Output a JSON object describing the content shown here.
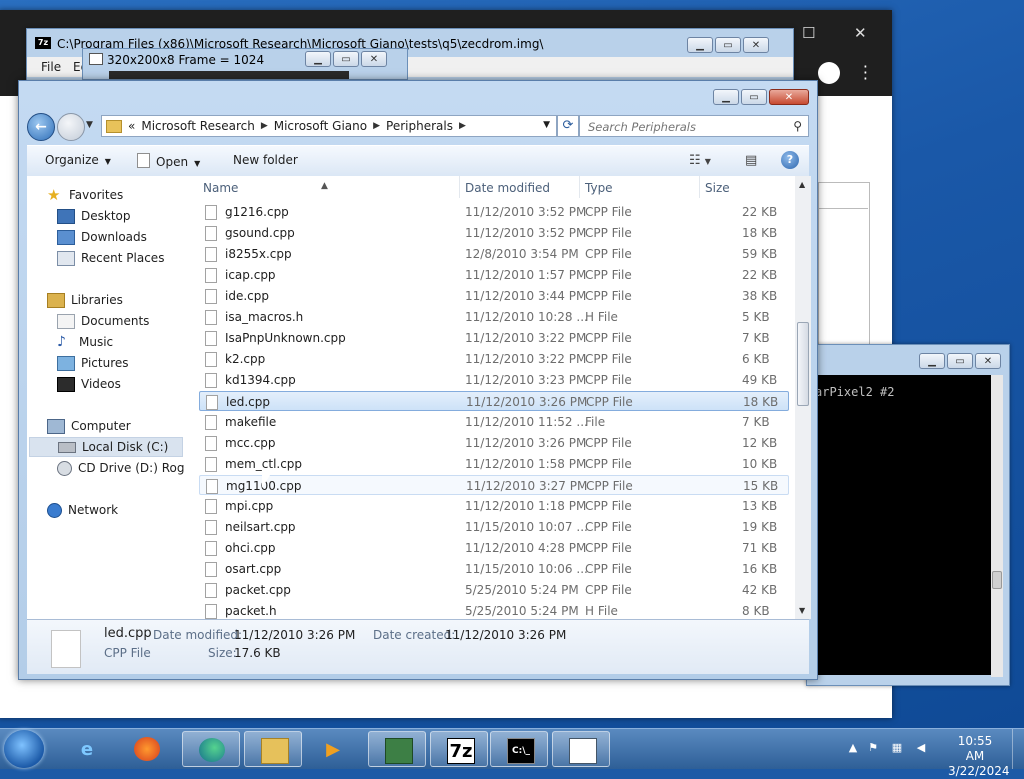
{
  "sevenzip": {
    "path": "C:\\Program Files (x86)\\Microsoft Research\\Microsoft Giano\\tests\\q5\\zecdrom.img\\",
    "menu_file": "File",
    "menu_edit": "Ed"
  },
  "frame_window": {
    "title": "320x200x8 Frame = 1024"
  },
  "console": {
    "text": "arPixel2 #2"
  },
  "explorer": {
    "breadcrumb": [
      "Microsoft Research",
      "Microsoft Giano",
      "Peripherals"
    ],
    "breadcrumb_overflow": "«",
    "search_placeholder": "Search Peripherals",
    "toolbar": {
      "organize": "Organize",
      "open": "Open",
      "new_folder": "New folder"
    },
    "nav": {
      "favorites": "Favorites",
      "desktop": "Desktop",
      "downloads": "Downloads",
      "recent": "Recent Places",
      "libraries": "Libraries",
      "documents": "Documents",
      "music": "Music",
      "pictures": "Pictures",
      "videos": "Videos",
      "computer": "Computer",
      "local_disk": "Local Disk (C:)",
      "cd_drive": "CD Drive (D:) Rogue",
      "network": "Network"
    },
    "columns": {
      "name": "Name",
      "date": "Date modified",
      "type": "Type",
      "size": "Size"
    },
    "files": [
      {
        "name": "g1216.cpp",
        "date": "11/12/2010 3:52 PM",
        "type": "CPP File",
        "size": "22 KB"
      },
      {
        "name": "gsound.cpp",
        "date": "11/12/2010 3:52 PM",
        "type": "CPP File",
        "size": "18 KB"
      },
      {
        "name": "i8255x.cpp",
        "date": "12/8/2010 3:54 PM",
        "type": "CPP File",
        "size": "59 KB"
      },
      {
        "name": "icap.cpp",
        "date": "11/12/2010 1:57 PM",
        "type": "CPP File",
        "size": "22 KB"
      },
      {
        "name": "ide.cpp",
        "date": "11/12/2010 3:44 PM",
        "type": "CPP File",
        "size": "38 KB"
      },
      {
        "name": "isa_macros.h",
        "date": "11/12/2010 10:28 ...",
        "type": "H File",
        "size": "5 KB"
      },
      {
        "name": "IsaPnpUnknown.cpp",
        "date": "11/12/2010 3:22 PM",
        "type": "CPP File",
        "size": "7 KB"
      },
      {
        "name": "k2.cpp",
        "date": "11/12/2010 3:22 PM",
        "type": "CPP File",
        "size": "6 KB"
      },
      {
        "name": "kd1394.cpp",
        "date": "11/12/2010 3:23 PM",
        "type": "CPP File",
        "size": "49 KB"
      },
      {
        "name": "led.cpp",
        "date": "11/12/2010 3:26 PM",
        "type": "CPP File",
        "size": "18 KB"
      },
      {
        "name": "makefile",
        "date": "11/12/2010 11:52 ...",
        "type": "File",
        "size": "7 KB"
      },
      {
        "name": "mcc.cpp",
        "date": "11/12/2010 3:26 PM",
        "type": "CPP File",
        "size": "12 KB"
      },
      {
        "name": "mem_ctl.cpp",
        "date": "11/12/2010 1:58 PM",
        "type": "CPP File",
        "size": "10 KB"
      },
      {
        "name": "mg1100.cpp",
        "date": "11/12/2010 3:27 PM",
        "type": "CPP File",
        "size": "15 KB"
      },
      {
        "name": "mpi.cpp",
        "date": "11/12/2010 1:18 PM",
        "type": "CPP File",
        "size": "13 KB"
      },
      {
        "name": "neilsart.cpp",
        "date": "11/15/2010 10:07 ...",
        "type": "CPP File",
        "size": "19 KB"
      },
      {
        "name": "ohci.cpp",
        "date": "11/12/2010 4:28 PM",
        "type": "CPP File",
        "size": "71 KB"
      },
      {
        "name": "osart.cpp",
        "date": "11/15/2010 10:06 ...",
        "type": "CPP File",
        "size": "16 KB"
      },
      {
        "name": "packet.cpp",
        "date": "5/25/2010 5:24 PM",
        "type": "CPP File",
        "size": "42 KB"
      },
      {
        "name": "packet.h",
        "date": "5/25/2010 5:24 PM",
        "type": "H File",
        "size": "8 KB"
      }
    ],
    "details": {
      "name": "led.cpp",
      "type": "CPP File",
      "date_modified_label": "Date modified:",
      "date_modified": "11/12/2010 3:26 PM",
      "date_created_label": "Date created:",
      "date_created": "11/12/2010 3:26 PM",
      "size_label": "Size:",
      "size": "17.6 KB"
    }
  },
  "taskbar": {
    "time": "10:55 AM",
    "date": "3/22/2024",
    "sevenzip_label": "7z"
  }
}
